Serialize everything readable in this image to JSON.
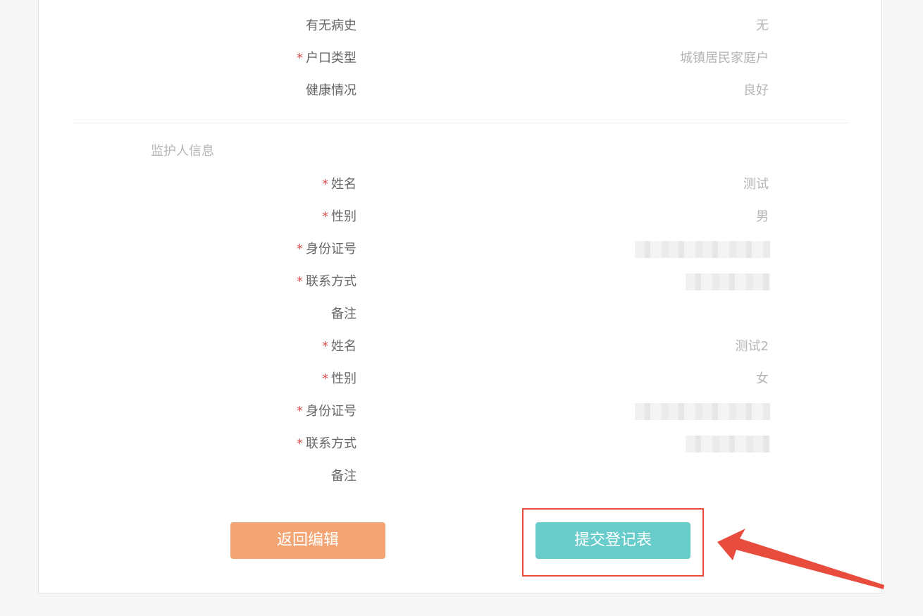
{
  "personal_info": {
    "rows": [
      {
        "label": "有无病史",
        "required": false,
        "value": "无"
      },
      {
        "label": "户口类型",
        "required": true,
        "value": "城镇居民家庭户"
      },
      {
        "label": "健康情况",
        "required": false,
        "value": "良好"
      }
    ]
  },
  "guardian_section": {
    "title": "监护人信息",
    "guardians": [
      {
        "name_label": "姓名",
        "name_value": "测试",
        "gender_label": "性别",
        "gender_value": "男",
        "id_label": "身份证号",
        "phone_label": "联系方式",
        "note_label": "备注",
        "note_value": ""
      },
      {
        "name_label": "姓名",
        "name_value": "测试2",
        "gender_label": "性别",
        "gender_value": "女",
        "id_label": "身份证号",
        "phone_label": "联系方式",
        "note_label": "备注",
        "note_value": ""
      }
    ]
  },
  "required_marker": "*",
  "actions": {
    "back_label": "返回编辑",
    "submit_label": "提交登记表"
  },
  "colors": {
    "back_button": "#f3a472",
    "submit_button": "#68cccb",
    "highlight": "#e74c3c",
    "required": "#e04f4f"
  }
}
